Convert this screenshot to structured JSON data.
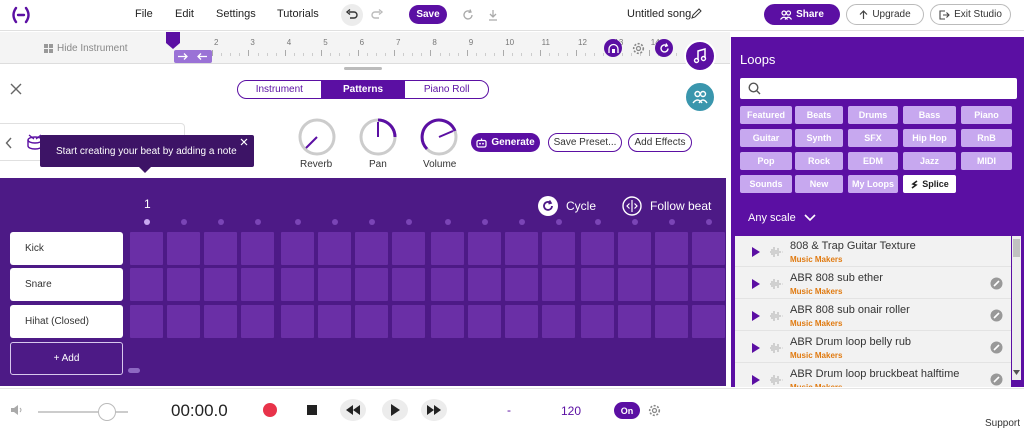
{
  "menu": {
    "file": "File",
    "edit": "Edit",
    "settings": "Settings",
    "tutorials": "Tutorials",
    "save": "Save"
  },
  "song_title": "Untitled song",
  "header": {
    "share": "Share",
    "upgrade": "Upgrade",
    "exit": "Exit Studio"
  },
  "ruler": {
    "hide_instrument": "Hide Instrument",
    "ticks": [
      "2",
      "3",
      "4",
      "5",
      "6",
      "7",
      "8",
      "9",
      "10",
      "11",
      "12",
      "13",
      "14"
    ]
  },
  "tabs": [
    "Instrument",
    "Patterns",
    "Piano Roll"
  ],
  "knobs": {
    "reverb": "Reverb",
    "pan": "Pan",
    "volume": "Volume"
  },
  "actions": {
    "generate": "Generate",
    "save_preset": "Save Preset...",
    "add_effects": "Add Effects"
  },
  "tooltip": "Start creating your beat by adding a note",
  "beat": {
    "bar_number": "1",
    "cycle": "Cycle",
    "follow_beat": "Follow beat",
    "rows": [
      "Kick",
      "Snare",
      "Hihat (Closed)"
    ],
    "add": "+ Add"
  },
  "transport": {
    "time": "00:00.0",
    "key": "-",
    "bpm": "120",
    "metronome": "On"
  },
  "loops": {
    "title": "Loops",
    "categories": [
      "Featured",
      "Beats",
      "Drums",
      "Bass",
      "Piano",
      "Guitar",
      "Synth",
      "SFX",
      "Hip Hop",
      "RnB",
      "Pop",
      "Rock",
      "EDM",
      "Jazz",
      "MIDI",
      "Sounds",
      "New",
      "My Loops",
      "Splice"
    ],
    "scale": "Any scale",
    "items": [
      {
        "name": "808 & Trap Guitar Texture",
        "maker": "Music Makers"
      },
      {
        "name": "ABR 808 sub ether",
        "maker": "Music Makers"
      },
      {
        "name": "ABR 808 sub onair roller",
        "maker": "Music Makers"
      },
      {
        "name": "ABR Drum loop belly rub",
        "maker": "Music Makers"
      },
      {
        "name": "ABR Drum loop bruckbeat halftime",
        "maker": "Music Makers"
      }
    ]
  },
  "footer": {
    "support": "Support"
  },
  "colors": {
    "accent": "#5b0fa3",
    "beat_bg": "#4d1a86",
    "cell": "#6a2fa6",
    "chip": "#c7a8ef",
    "maker": "#e07a10"
  }
}
